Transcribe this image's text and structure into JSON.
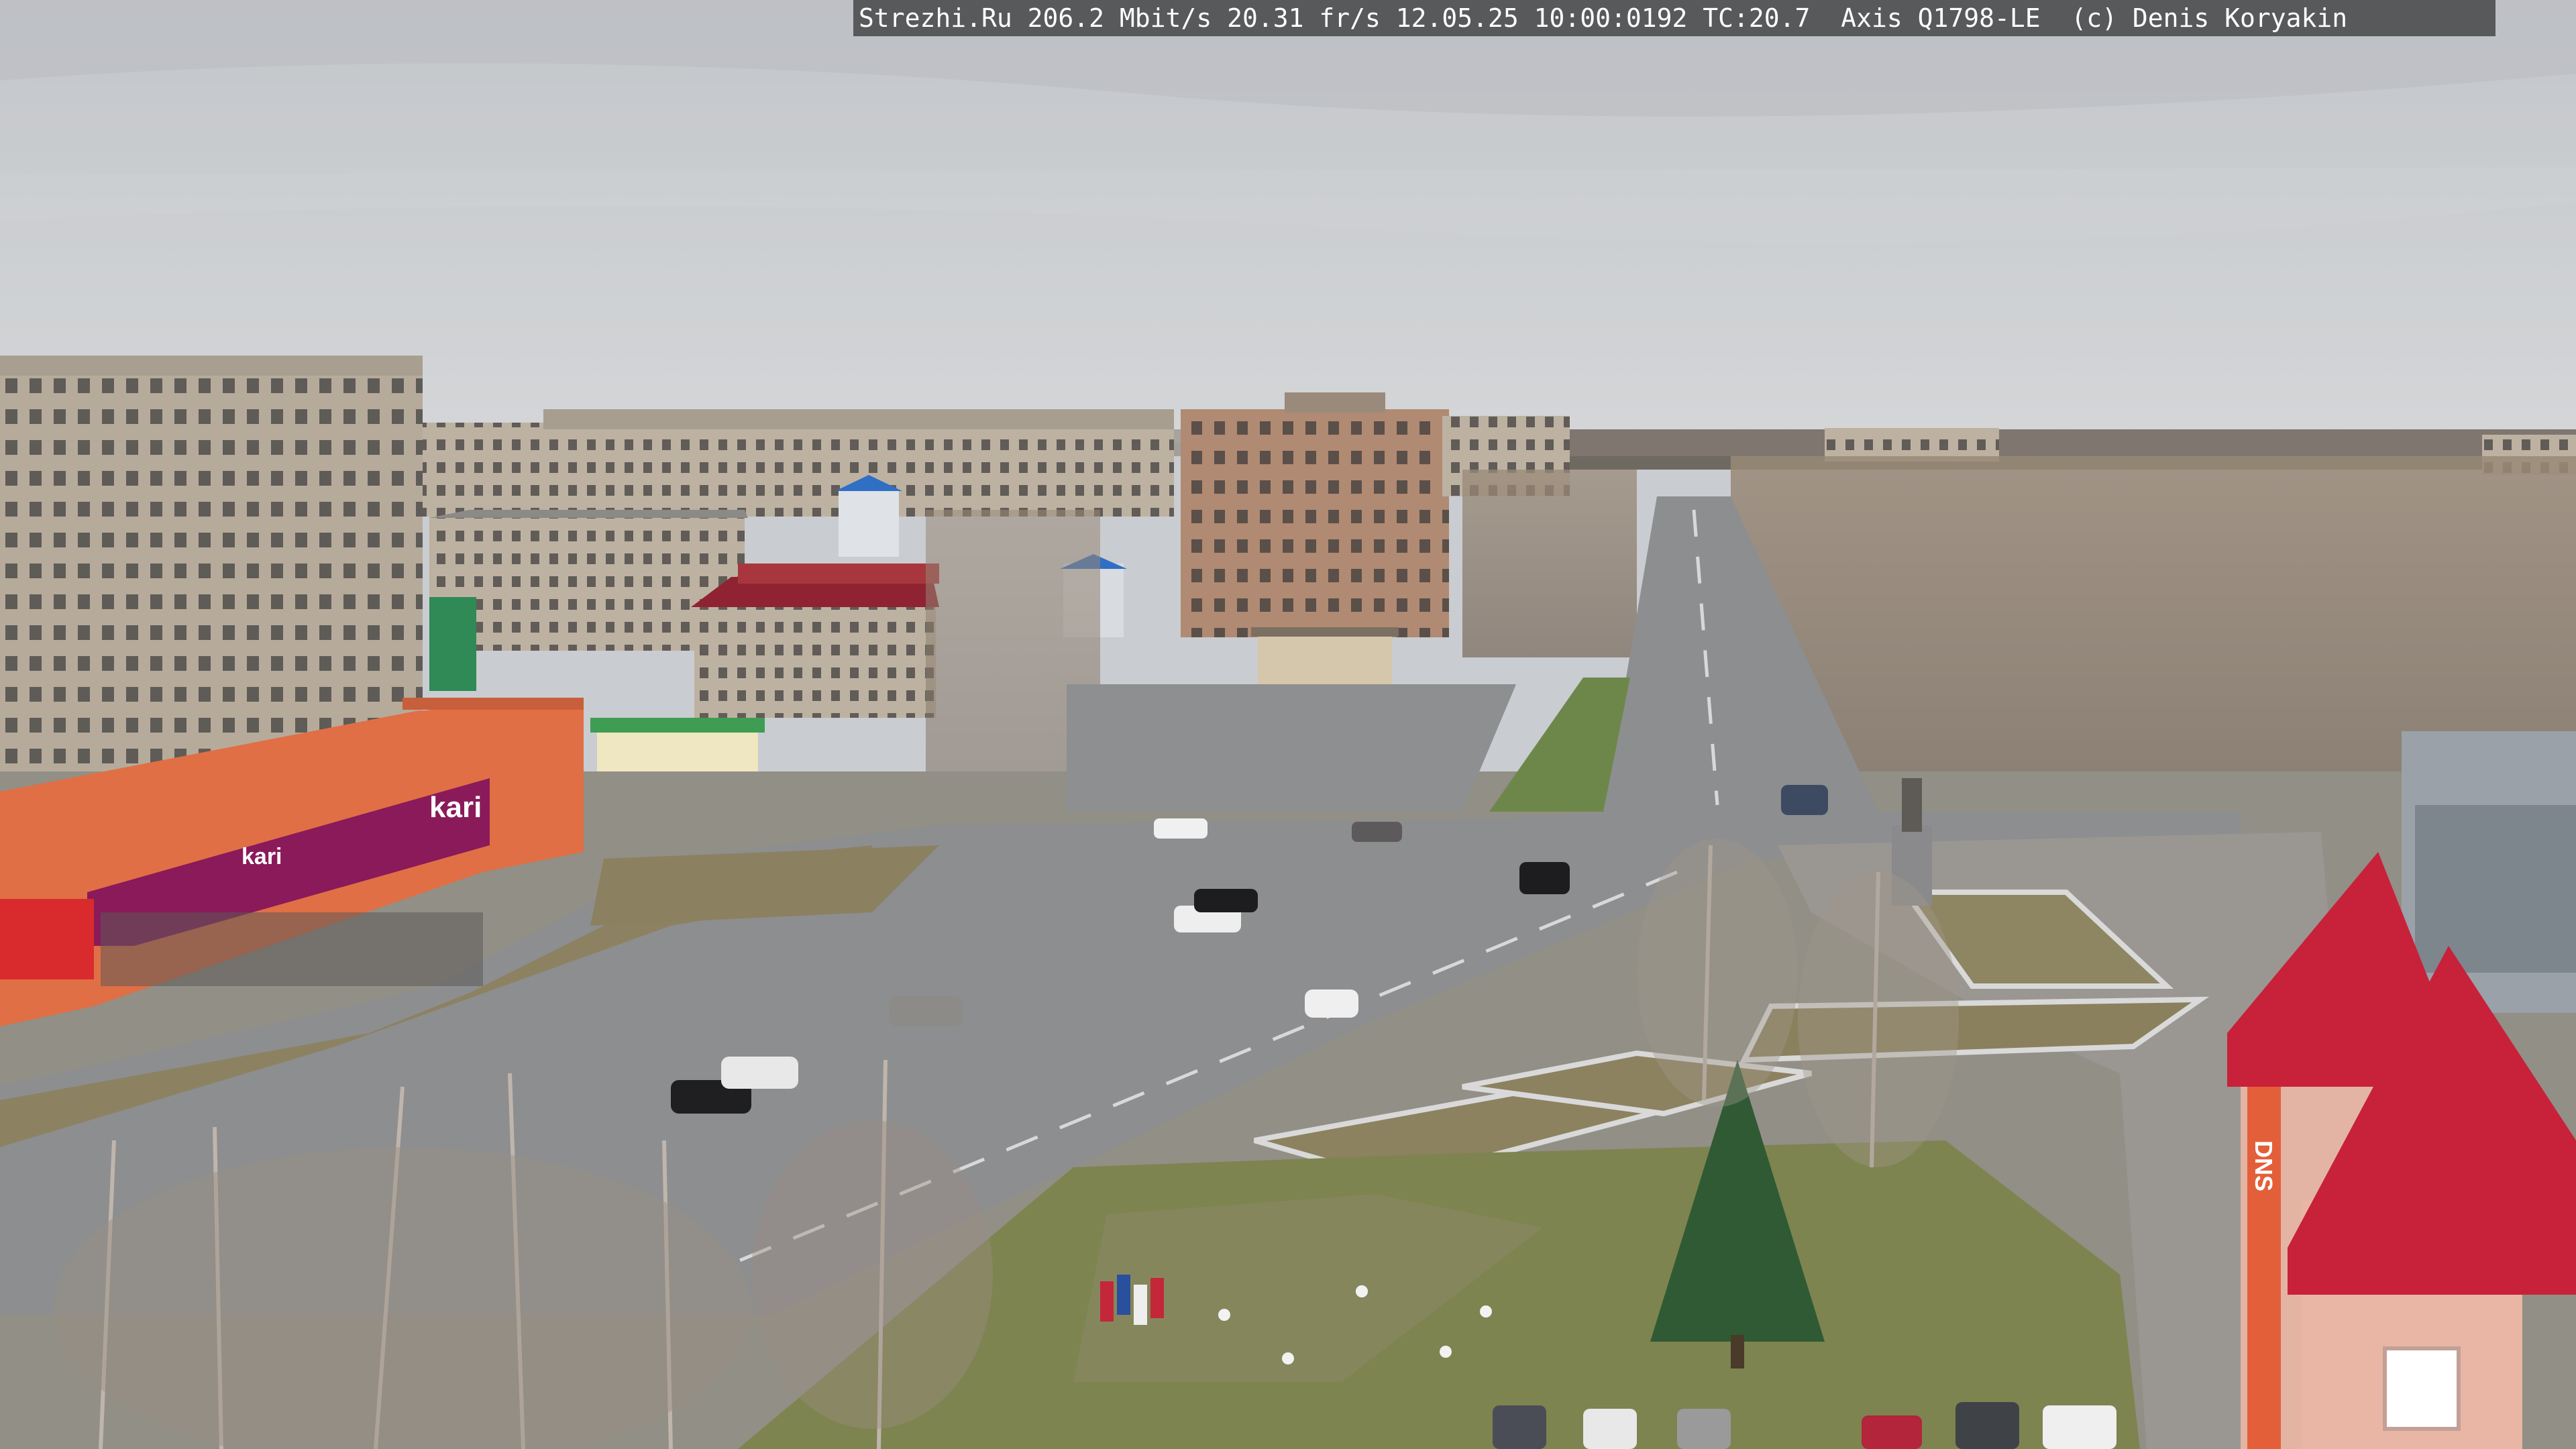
{
  "overlay": {
    "text": "Strezhi.Ru 206.2 Mbit/s 20.31 fr/s 12.05.25 10:00:0192 TC:20.7  Axis Q1798-LE  (c) Denis Koryakin"
  },
  "signs": {
    "store_left": "kari",
    "store_left_small": "kari",
    "store_right": "DNS"
  },
  "colors": {
    "sky": "#c8cbcf",
    "road": "#8f9092",
    "panel_buildings": "#b8ad9d",
    "store_orange": "#e0734a",
    "store_magenta": "#8a1a5a",
    "roof_red": "#c8213a",
    "grass": "#8d8a60"
  }
}
